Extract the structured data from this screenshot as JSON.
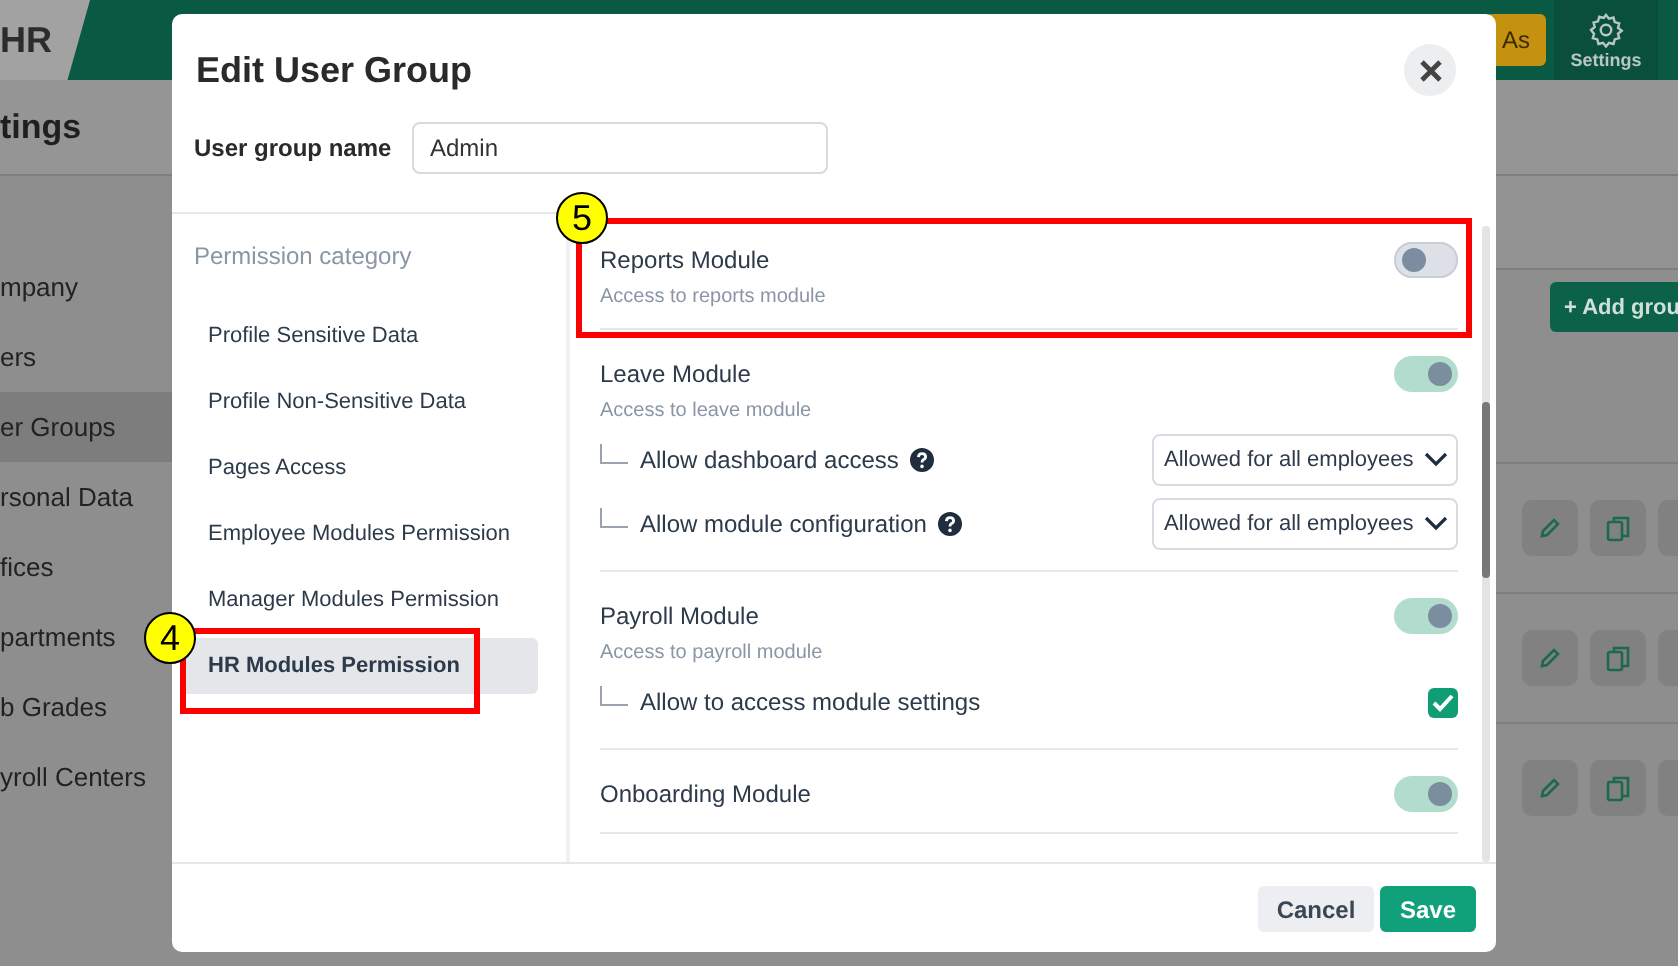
{
  "background": {
    "app_name": "HR",
    "header": {
      "view_as_button": "As",
      "settings": "Settings"
    },
    "page_title": "tings",
    "nav": [
      {
        "label": "mpany",
        "selected": false
      },
      {
        "label": "ers",
        "selected": false
      },
      {
        "label": "er Groups",
        "selected": true
      },
      {
        "label": "rsonal Data",
        "selected": false
      },
      {
        "label": "fices",
        "selected": false
      },
      {
        "label": "partments",
        "selected": false
      },
      {
        "label": "b Grades",
        "selected": false
      },
      {
        "label": "yroll Centers",
        "selected": false
      }
    ],
    "add_button": "+ Add grou"
  },
  "dialog": {
    "title": "Edit User Group",
    "name_field": {
      "label": "User group name",
      "value": "Admin"
    },
    "categories_header": "Permission category",
    "categories": [
      {
        "label": "Profile Sensitive Data",
        "selected": false
      },
      {
        "label": "Profile Non-Sensitive Data",
        "selected": false
      },
      {
        "label": "Pages Access",
        "selected": false
      },
      {
        "label": "Employee Modules Permission",
        "selected": false
      },
      {
        "label": "Manager Modules Permission",
        "selected": false
      },
      {
        "label": "HR Modules Permission",
        "selected": true,
        "callout": "4"
      }
    ],
    "modules": [
      {
        "title": "Reports Module",
        "description": "Access to reports module",
        "on": false,
        "callout": "5"
      },
      {
        "title": "Leave Module",
        "description": "Access to leave module",
        "on": true,
        "options": [
          {
            "kind": "select",
            "label": "Allow dashboard access",
            "help": true,
            "value": "Allowed for all employees"
          },
          {
            "kind": "select",
            "label": "Allow module configuration",
            "help": true,
            "value": "Allowed for all employees"
          }
        ]
      },
      {
        "title": "Payroll Module",
        "description": "Access to payroll module",
        "on": true,
        "options": [
          {
            "kind": "checkbox",
            "label": "Allow to access module settings",
            "checked": true
          }
        ]
      },
      {
        "title": "Onboarding Module",
        "on": true
      }
    ],
    "buttons": {
      "cancel": "Cancel",
      "save": "Save"
    }
  }
}
